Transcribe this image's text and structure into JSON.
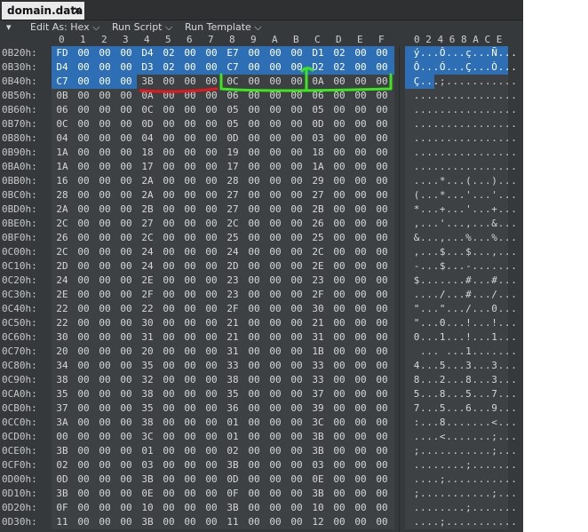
{
  "tab": {
    "title": "domain.data",
    "close_glyph": "✕"
  },
  "toolbar": {
    "arrow_glyph": "▾",
    "edit_as": "Edit As: Hex",
    "run_script": "Run Script",
    "run_template": "Run Template",
    "chevron": "⌵"
  },
  "columns": [
    "0",
    "1",
    "2",
    "3",
    "4",
    "5",
    "6",
    "7",
    "8",
    "9",
    "A",
    "B",
    "C",
    "D",
    "E",
    "F"
  ],
  "ascii_header": "0 2 4 6 8 A C E",
  "rows": [
    {
      "addr": "0B20h:",
      "bytes": [
        "FD",
        "00",
        "00",
        "00",
        "D4",
        "02",
        "00",
        "00",
        "E7",
        "00",
        "00",
        "00",
        "D1",
        "02",
        "00",
        "00"
      ],
      "ascii": [
        "ý",
        ".",
        ".",
        ".",
        "Ô",
        ".",
        ".",
        ".",
        "ç",
        ".",
        ".",
        ".",
        "Ñ",
        ".",
        ".",
        "."
      ]
    },
    {
      "addr": "0B30h:",
      "bytes": [
        "D4",
        "00",
        "00",
        "00",
        "D3",
        "02",
        "00",
        "00",
        "C7",
        "00",
        "00",
        "00",
        "D2",
        "02",
        "00",
        "00"
      ],
      "ascii": [
        "Ô",
        ".",
        ".",
        ".",
        "Ó",
        ".",
        ".",
        ".",
        "Ç",
        ".",
        ".",
        ".",
        "Ò",
        ".",
        ".",
        "."
      ]
    },
    {
      "addr": "0B40h:",
      "bytes": [
        "C7",
        "00",
        "00",
        "00",
        "3B",
        "00",
        "00",
        "00",
        "0C",
        "00",
        "00",
        "00",
        "0A",
        "00",
        "00",
        "00"
      ],
      "ascii": [
        "Ç",
        ".",
        ".",
        ".",
        ";",
        ".",
        ".",
        ".",
        ".",
        ".",
        ".",
        ".",
        ".",
        ".",
        ".",
        "."
      ]
    },
    {
      "addr": "0B50h:",
      "bytes": [
        "0B",
        "00",
        "00",
        "00",
        "0A",
        "00",
        "00",
        "00",
        "06",
        "00",
        "00",
        "00",
        "06",
        "00",
        "00",
        "00"
      ],
      "ascii": [
        ".",
        ".",
        ".",
        ".",
        ".",
        ".",
        ".",
        ".",
        ".",
        ".",
        ".",
        ".",
        ".",
        ".",
        ".",
        "."
      ]
    },
    {
      "addr": "0B60h:",
      "bytes": [
        "06",
        "00",
        "00",
        "00",
        "0C",
        "00",
        "00",
        "00",
        "05",
        "00",
        "00",
        "00",
        "05",
        "00",
        "00",
        "00"
      ],
      "ascii": [
        ".",
        ".",
        ".",
        ".",
        ".",
        ".",
        ".",
        ".",
        ".",
        ".",
        ".",
        ".",
        ".",
        ".",
        ".",
        "."
      ]
    },
    {
      "addr": "0B70h:",
      "bytes": [
        "0C",
        "00",
        "00",
        "00",
        "0D",
        "00",
        "00",
        "00",
        "05",
        "00",
        "00",
        "00",
        "0D",
        "00",
        "00",
        "00"
      ],
      "ascii": [
        ".",
        ".",
        ".",
        ".",
        ".",
        ".",
        ".",
        ".",
        ".",
        ".",
        ".",
        ".",
        ".",
        ".",
        ".",
        "."
      ]
    },
    {
      "addr": "0B80h:",
      "bytes": [
        "04",
        "00",
        "00",
        "00",
        "04",
        "00",
        "00",
        "00",
        "0D",
        "00",
        "00",
        "00",
        "03",
        "00",
        "00",
        "00"
      ],
      "ascii": [
        ".",
        ".",
        ".",
        ".",
        ".",
        ".",
        ".",
        ".",
        ".",
        ".",
        ".",
        ".",
        ".",
        ".",
        ".",
        "."
      ]
    },
    {
      "addr": "0B90h:",
      "bytes": [
        "1A",
        "00",
        "00",
        "00",
        "18",
        "00",
        "00",
        "00",
        "19",
        "00",
        "00",
        "00",
        "18",
        "00",
        "00",
        "00"
      ],
      "ascii": [
        ".",
        ".",
        ".",
        ".",
        ".",
        ".",
        ".",
        ".",
        ".",
        ".",
        ".",
        ".",
        ".",
        ".",
        ".",
        "."
      ]
    },
    {
      "addr": "0BA0h:",
      "bytes": [
        "1A",
        "00",
        "00",
        "00",
        "17",
        "00",
        "00",
        "00",
        "17",
        "00",
        "00",
        "00",
        "1A",
        "00",
        "00",
        "00"
      ],
      "ascii": [
        ".",
        ".",
        ".",
        ".",
        ".",
        ".",
        ".",
        ".",
        ".",
        ".",
        ".",
        ".",
        ".",
        ".",
        ".",
        "."
      ]
    },
    {
      "addr": "0BB0h:",
      "bytes": [
        "16",
        "00",
        "00",
        "00",
        "2A",
        "00",
        "00",
        "00",
        "28",
        "00",
        "00",
        "00",
        "29",
        "00",
        "00",
        "00"
      ],
      "ascii": [
        ".",
        ".",
        ".",
        ".",
        "*",
        ".",
        ".",
        ".",
        "(",
        ".",
        ".",
        ".",
        ")",
        ".",
        ".",
        "."
      ]
    },
    {
      "addr": "0BC0h:",
      "bytes": [
        "28",
        "00",
        "00",
        "00",
        "2A",
        "00",
        "00",
        "00",
        "27",
        "00",
        "00",
        "00",
        "27",
        "00",
        "00",
        "00"
      ],
      "ascii": [
        "(",
        ".",
        ".",
        ".",
        "*",
        ".",
        ".",
        ".",
        "'",
        ".",
        ".",
        ".",
        "'",
        ".",
        ".",
        "."
      ]
    },
    {
      "addr": "0BD0h:",
      "bytes": [
        "2A",
        "00",
        "00",
        "00",
        "2B",
        "00",
        "00",
        "00",
        "27",
        "00",
        "00",
        "00",
        "2B",
        "00",
        "00",
        "00"
      ],
      "ascii": [
        "*",
        ".",
        ".",
        ".",
        "+",
        ".",
        ".",
        ".",
        "'",
        ".",
        ".",
        ".",
        "+",
        ".",
        ".",
        "."
      ]
    },
    {
      "addr": "0BE0h:",
      "bytes": [
        "2C",
        "00",
        "00",
        "00",
        "27",
        "00",
        "00",
        "00",
        "2C",
        "00",
        "00",
        "00",
        "26",
        "00",
        "00",
        "00"
      ],
      "ascii": [
        ",",
        ".",
        ".",
        ".",
        "'",
        ".",
        ".",
        ".",
        ",",
        ".",
        ".",
        ".",
        "&",
        ".",
        ".",
        "."
      ]
    },
    {
      "addr": "0BF0h:",
      "bytes": [
        "26",
        "00",
        "00",
        "00",
        "2C",
        "00",
        "00",
        "00",
        "25",
        "00",
        "00",
        "00",
        "25",
        "00",
        "00",
        "00"
      ],
      "ascii": [
        "&",
        ".",
        ".",
        ".",
        ",",
        ".",
        ".",
        ".",
        "%",
        ".",
        ".",
        ".",
        "%",
        ".",
        ".",
        "."
      ]
    },
    {
      "addr": "0C00h:",
      "bytes": [
        "2C",
        "00",
        "00",
        "00",
        "24",
        "00",
        "00",
        "00",
        "24",
        "00",
        "00",
        "00",
        "2C",
        "00",
        "00",
        "00"
      ],
      "ascii": [
        ",",
        ".",
        ".",
        ".",
        "$",
        ".",
        ".",
        ".",
        "$",
        ".",
        ".",
        ".",
        ",",
        ".",
        ".",
        "."
      ]
    },
    {
      "addr": "0C10h:",
      "bytes": [
        "2D",
        "00",
        "00",
        "00",
        "24",
        "00",
        "00",
        "00",
        "2D",
        "00",
        "00",
        "00",
        "2E",
        "00",
        "00",
        "00"
      ],
      "ascii": [
        "-",
        ".",
        ".",
        ".",
        "$",
        ".",
        ".",
        ".",
        "-",
        ".",
        ".",
        ".",
        ".",
        ".",
        ".",
        "."
      ]
    },
    {
      "addr": "0C20h:",
      "bytes": [
        "24",
        "00",
        "00",
        "00",
        "2E",
        "00",
        "00",
        "00",
        "23",
        "00",
        "00",
        "00",
        "23",
        "00",
        "00",
        "00"
      ],
      "ascii": [
        "$",
        ".",
        ".",
        ".",
        ".",
        ".",
        ".",
        ".",
        "#",
        ".",
        ".",
        ".",
        "#",
        ".",
        ".",
        "."
      ]
    },
    {
      "addr": "0C30h:",
      "bytes": [
        "2E",
        "00",
        "00",
        "00",
        "2F",
        "00",
        "00",
        "00",
        "23",
        "00",
        "00",
        "00",
        "2F",
        "00",
        "00",
        "00"
      ],
      "ascii": [
        ".",
        ".",
        ".",
        ".",
        "/",
        ".",
        ".",
        ".",
        "#",
        ".",
        ".",
        ".",
        "/",
        ".",
        ".",
        "."
      ]
    },
    {
      "addr": "0C40h:",
      "bytes": [
        "22",
        "00",
        "00",
        "00",
        "22",
        "00",
        "00",
        "00",
        "2F",
        "00",
        "00",
        "00",
        "30",
        "00",
        "00",
        "00"
      ],
      "ascii": [
        "\"",
        ".",
        ".",
        ".",
        "\"",
        ".",
        ".",
        ".",
        "/",
        ".",
        ".",
        ".",
        "0",
        ".",
        ".",
        "."
      ]
    },
    {
      "addr": "0C50h:",
      "bytes": [
        "22",
        "00",
        "00",
        "00",
        "30",
        "00",
        "00",
        "00",
        "21",
        "00",
        "00",
        "00",
        "21",
        "00",
        "00",
        "00"
      ],
      "ascii": [
        "\"",
        ".",
        ".",
        ".",
        "0",
        ".",
        ".",
        ".",
        "!",
        ".",
        ".",
        ".",
        "!",
        ".",
        ".",
        "."
      ]
    },
    {
      "addr": "0C60h:",
      "bytes": [
        "30",
        "00",
        "00",
        "00",
        "31",
        "00",
        "00",
        "00",
        "21",
        "00",
        "00",
        "00",
        "31",
        "00",
        "00",
        "00"
      ],
      "ascii": [
        "0",
        ".",
        ".",
        ".",
        "1",
        ".",
        ".",
        ".",
        "!",
        ".",
        ".",
        ".",
        "1",
        ".",
        ".",
        "."
      ]
    },
    {
      "addr": "0C70h:",
      "bytes": [
        "20",
        "00",
        "00",
        "00",
        "20",
        "00",
        "00",
        "00",
        "31",
        "00",
        "00",
        "00",
        "1B",
        "00",
        "00",
        "00"
      ],
      "ascii": [
        " ",
        ".",
        ".",
        ".",
        " ",
        ".",
        ".",
        ".",
        "1",
        ".",
        ".",
        ".",
        ".",
        ".",
        ".",
        "."
      ]
    },
    {
      "addr": "0C80h:",
      "bytes": [
        "34",
        "00",
        "00",
        "00",
        "35",
        "00",
        "00",
        "00",
        "33",
        "00",
        "00",
        "00",
        "33",
        "00",
        "00",
        "00"
      ],
      "ascii": [
        "4",
        ".",
        ".",
        ".",
        "5",
        ".",
        ".",
        ".",
        "3",
        ".",
        ".",
        ".",
        "3",
        ".",
        ".",
        "."
      ]
    },
    {
      "addr": "0C90h:",
      "bytes": [
        "38",
        "00",
        "00",
        "00",
        "32",
        "00",
        "00",
        "00",
        "38",
        "00",
        "00",
        "00",
        "33",
        "00",
        "00",
        "00"
      ],
      "ascii": [
        "8",
        ".",
        ".",
        ".",
        "2",
        ".",
        ".",
        ".",
        "8",
        ".",
        ".",
        ".",
        "3",
        ".",
        ".",
        "."
      ]
    },
    {
      "addr": "0CA0h:",
      "bytes": [
        "35",
        "00",
        "00",
        "00",
        "38",
        "00",
        "00",
        "00",
        "35",
        "00",
        "00",
        "00",
        "37",
        "00",
        "00",
        "00"
      ],
      "ascii": [
        "5",
        ".",
        ".",
        ".",
        "8",
        ".",
        ".",
        ".",
        "5",
        ".",
        ".",
        ".",
        "7",
        ".",
        ".",
        "."
      ]
    },
    {
      "addr": "0CB0h:",
      "bytes": [
        "37",
        "00",
        "00",
        "00",
        "35",
        "00",
        "00",
        "00",
        "36",
        "00",
        "00",
        "00",
        "39",
        "00",
        "00",
        "00"
      ],
      "ascii": [
        "7",
        ".",
        ".",
        ".",
        "5",
        ".",
        ".",
        ".",
        "6",
        ".",
        ".",
        ".",
        "9",
        ".",
        ".",
        "."
      ]
    },
    {
      "addr": "0CC0h:",
      "bytes": [
        "3A",
        "00",
        "00",
        "00",
        "38",
        "00",
        "00",
        "00",
        "01",
        "00",
        "00",
        "00",
        "3C",
        "00",
        "00",
        "00"
      ],
      "ascii": [
        ":",
        ".",
        ".",
        ".",
        "8",
        ".",
        ".",
        ".",
        ".",
        ".",
        ".",
        ".",
        "<",
        ".",
        ".",
        "."
      ]
    },
    {
      "addr": "0CD0h:",
      "bytes": [
        "00",
        "00",
        "00",
        "00",
        "3C",
        "00",
        "00",
        "00",
        "01",
        "00",
        "00",
        "00",
        "3B",
        "00",
        "00",
        "00"
      ],
      "ascii": [
        ".",
        ".",
        ".",
        ".",
        "<",
        ".",
        ".",
        ".",
        ".",
        ".",
        ".",
        ".",
        ";",
        ".",
        ".",
        "."
      ]
    },
    {
      "addr": "0CE0h:",
      "bytes": [
        "3B",
        "00",
        "00",
        "00",
        "01",
        "00",
        "00",
        "00",
        "02",
        "00",
        "00",
        "00",
        "3B",
        "00",
        "00",
        "00"
      ],
      "ascii": [
        ";",
        ".",
        ".",
        ".",
        ".",
        ".",
        ".",
        ".",
        ".",
        ".",
        ".",
        ".",
        ";",
        ".",
        ".",
        "."
      ]
    },
    {
      "addr": "0CF0h:",
      "bytes": [
        "02",
        "00",
        "00",
        "00",
        "03",
        "00",
        "00",
        "00",
        "3B",
        "00",
        "00",
        "00",
        "03",
        "00",
        "00",
        "00"
      ],
      "ascii": [
        ".",
        ".",
        ".",
        ".",
        ".",
        ".",
        ".",
        ".",
        ";",
        ".",
        ".",
        ".",
        ".",
        ".",
        ".",
        "."
      ]
    },
    {
      "addr": "0D00h:",
      "bytes": [
        "0D",
        "00",
        "00",
        "00",
        "3B",
        "00",
        "00",
        "00",
        "0D",
        "00",
        "00",
        "00",
        "0E",
        "00",
        "00",
        "00"
      ],
      "ascii": [
        ".",
        ".",
        ".",
        ".",
        ";",
        ".",
        ".",
        ".",
        ".",
        ".",
        ".",
        ".",
        ".",
        ".",
        ".",
        "."
      ]
    },
    {
      "addr": "0D10h:",
      "bytes": [
        "3B",
        "00",
        "00",
        "00",
        "0E",
        "00",
        "00",
        "00",
        "0F",
        "00",
        "00",
        "00",
        "3B",
        "00",
        "00",
        "00"
      ],
      "ascii": [
        ";",
        ".",
        ".",
        ".",
        ".",
        ".",
        ".",
        ".",
        ".",
        ".",
        ".",
        ".",
        ";",
        ".",
        ".",
        "."
      ]
    },
    {
      "addr": "0D20h:",
      "bytes": [
        "0F",
        "00",
        "00",
        "00",
        "10",
        "00",
        "00",
        "00",
        "3B",
        "00",
        "00",
        "00",
        "10",
        "00",
        "00",
        "00"
      ],
      "ascii": [
        ".",
        ".",
        ".",
        ".",
        ".",
        ".",
        ".",
        ".",
        ";",
        ".",
        ".",
        ".",
        ".",
        ".",
        ".",
        "."
      ]
    },
    {
      "addr": "0D30h:",
      "bytes": [
        "11",
        "00",
        "00",
        "00",
        "3B",
        "00",
        "00",
        "00",
        "11",
        "00",
        "00",
        "00",
        "12",
        "00",
        "00",
        "00"
      ],
      "ascii": [
        ".",
        ".",
        ".",
        ".",
        ";",
        ".",
        ".",
        ".",
        ".",
        ".",
        ".",
        ".",
        ".",
        ".",
        ".",
        "."
      ]
    }
  ],
  "colors": {
    "selection": "#2d6eb4",
    "underline_red": "#e8161a",
    "bracket_green": "#3ce61e"
  }
}
